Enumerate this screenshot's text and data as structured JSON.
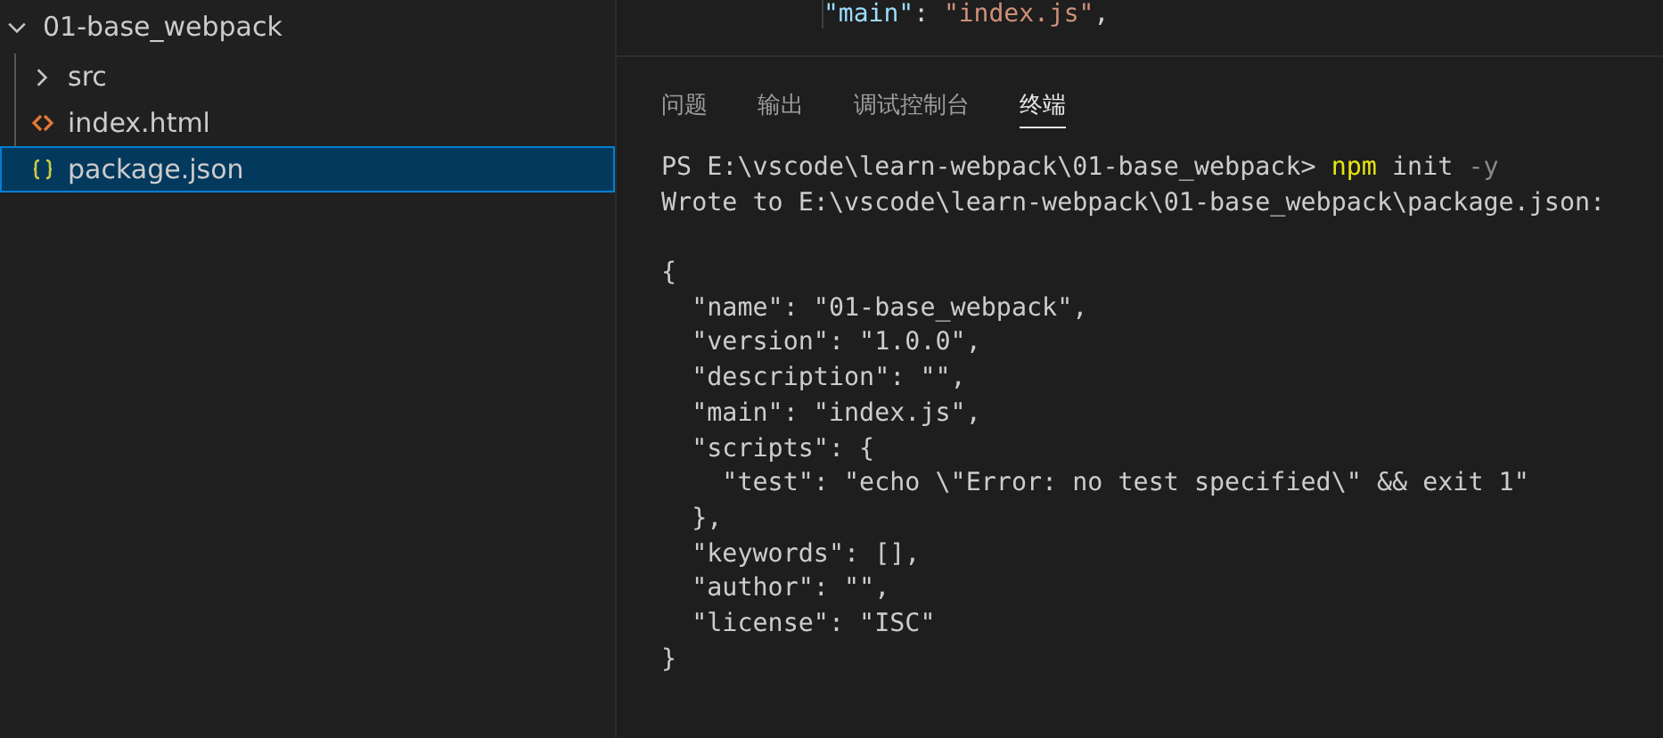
{
  "explorer": {
    "root": {
      "label": "01-base_webpack",
      "expanded": true,
      "children": [
        {
          "label": "src",
          "kind": "folder",
          "expanded": false,
          "selected": false
        },
        {
          "label": "index.html",
          "kind": "html",
          "selected": false
        },
        {
          "label": "package.json",
          "kind": "json",
          "selected": true
        }
      ]
    }
  },
  "editor": {
    "lines": [
      {
        "key": "\"main\"",
        "sep": ": ",
        "value": "\"index.js\"",
        "end": ","
      }
    ]
  },
  "panel": {
    "tabs": [
      {
        "label": "问题",
        "selected": false
      },
      {
        "label": "输出",
        "selected": false
      },
      {
        "label": "调试控制台",
        "selected": false
      },
      {
        "label": "终端",
        "selected": true
      }
    ],
    "terminal": [
      {
        "kind": "text",
        "parts": [
          {
            "text": "PS E:\\vscode\\learn-webpack\\01-base_webpack> ",
            "kind": "plain"
          },
          {
            "text": "npm",
            "kind": "command"
          },
          {
            "text": " init ",
            "kind": "plain"
          },
          {
            "text": "-y",
            "kind": "flag"
          }
        ]
      },
      {
        "kind": "text",
        "parts": [
          {
            "text": "Wrote to E:\\vscode\\learn-webpack\\01-base_webpack\\package.json:",
            "kind": "plain"
          }
        ]
      },
      {
        "kind": "blank"
      },
      {
        "kind": "text",
        "parts": [
          {
            "text": "{",
            "kind": "plain"
          }
        ]
      },
      {
        "kind": "text",
        "parts": [
          {
            "text": "  \"name\": \"01-base_webpack\",",
            "kind": "plain"
          }
        ]
      },
      {
        "kind": "text",
        "parts": [
          {
            "text": "  \"version\": \"1.0.0\",",
            "kind": "plain"
          }
        ]
      },
      {
        "kind": "text",
        "parts": [
          {
            "text": "  \"description\": \"\",",
            "kind": "plain"
          }
        ]
      },
      {
        "kind": "text",
        "parts": [
          {
            "text": "  \"main\": \"index.js\",",
            "kind": "plain"
          }
        ]
      },
      {
        "kind": "text",
        "parts": [
          {
            "text": "  \"scripts\": {",
            "kind": "plain"
          }
        ]
      },
      {
        "kind": "text",
        "parts": [
          {
            "text": "    \"test\": \"echo \\\"Error: no test specified\\\" && exit 1\"",
            "kind": "plain"
          }
        ]
      },
      {
        "kind": "text",
        "parts": [
          {
            "text": "  },",
            "kind": "plain"
          }
        ]
      },
      {
        "kind": "text",
        "parts": [
          {
            "text": "  \"keywords\": [],",
            "kind": "plain"
          }
        ]
      },
      {
        "kind": "text",
        "parts": [
          {
            "text": "  \"author\": \"\",",
            "kind": "plain"
          }
        ]
      },
      {
        "kind": "text",
        "parts": [
          {
            "text": "  \"license\": \"ISC\"",
            "kind": "plain"
          }
        ]
      },
      {
        "kind": "text",
        "parts": [
          {
            "text": "}",
            "kind": "plain"
          }
        ]
      }
    ]
  }
}
